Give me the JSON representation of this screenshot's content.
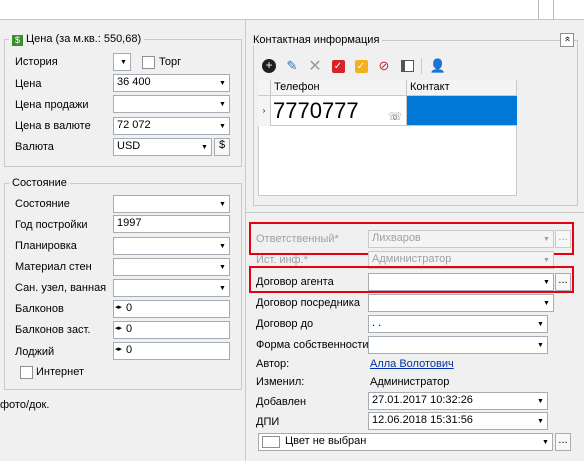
{
  "price_group": {
    "title": "Цена (за м.кв.: 550,68)",
    "history_label": "История",
    "bargain_label": "Торг",
    "price_label": "Цена",
    "price_value": "36 400",
    "sale_price_label": "Цена продажи",
    "sale_price_value": "",
    "currency_price_label": "Цена в валюте",
    "currency_price_value": "72 072",
    "currency_label": "Валюта",
    "currency_value": "USD",
    "currency_button": "$"
  },
  "state_group": {
    "title": "Состояние",
    "rows": [
      {
        "label": "Состояние",
        "value": ""
      },
      {
        "label": "Год постройки",
        "value": "1997"
      },
      {
        "label": "Планировка",
        "value": ""
      },
      {
        "label": "Материал стен",
        "value": ""
      },
      {
        "label": "Сан. узел, ванная",
        "value": ""
      }
    ],
    "spins": [
      {
        "label": "Балконов",
        "value": "0"
      },
      {
        "label": "Балконов заст.",
        "value": "0"
      },
      {
        "label": "Лоджий",
        "value": "0"
      }
    ],
    "internet_label": "Интернет"
  },
  "left_bottom_text": "фото/док.",
  "contact_group": {
    "title": "Контактная информация",
    "collapse_glyph": "«",
    "columns": [
      "Телефон",
      "Контакт"
    ],
    "rows": [
      {
        "phone": "7770777",
        "contact": ""
      }
    ]
  },
  "details": {
    "responsible_label": "Ответственный*",
    "responsible_value": "Лихваров",
    "source_label": "Ист. инф.*",
    "source_value": "Администратор",
    "agent_contract_label": "Договор агента",
    "agent_contract_value": "",
    "broker_contract_label": "Договор посредника",
    "broker_contract_value": "",
    "contract_until_label": "Договор до",
    "contract_until_value": " .  .",
    "ownership_label": "Форма собственности",
    "ownership_value": "",
    "author_label": "Автор:",
    "author_value": "Алла Волотович",
    "changed_label": "Изменил:",
    "changed_value": "Администратор",
    "added_label": "Добавлен",
    "added_value": "27.01.2017 10:32:26",
    "dpi_label": "ДПИ",
    "dpi_value": "12.06.2018 15:31:56",
    "color_value": "Цвет не выбран",
    "ellipsis": "..."
  },
  "colors": {
    "highlight": "#e60012",
    "selection": "#0078d7",
    "link": "#0033aa"
  }
}
